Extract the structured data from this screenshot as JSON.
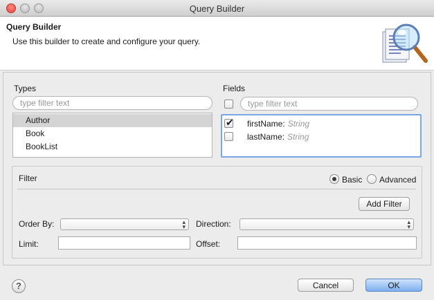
{
  "window": {
    "title": "Query Builder"
  },
  "header": {
    "title": "Query Builder",
    "description": "Use this builder to create and configure your query."
  },
  "types": {
    "label": "Types",
    "filter_placeholder": "type filter text",
    "items": [
      {
        "label": "Author",
        "selected": true
      },
      {
        "label": "Book",
        "selected": false
      },
      {
        "label": "BookList",
        "selected": false
      }
    ]
  },
  "fields": {
    "label": "Fields",
    "filter_placeholder": "type filter text",
    "select_all_checked": false,
    "items": [
      {
        "name": "firstName:",
        "type": "String",
        "checked": true
      },
      {
        "name": "lastName:",
        "type": "String",
        "checked": false
      }
    ]
  },
  "filter": {
    "label": "Filter",
    "mode_options": [
      "Basic",
      "Advanced"
    ],
    "selected_mode": "Basic",
    "add_filter_label": "Add Filter",
    "order_by_label": "Order By:",
    "order_by_value": "",
    "direction_label": "Direction:",
    "direction_value": "",
    "limit_label": "Limit:",
    "limit_value": "",
    "offset_label": "Offset:",
    "offset_value": ""
  },
  "footer": {
    "help_icon": "question-mark-icon",
    "cancel_label": "Cancel",
    "ok_label": "OK"
  },
  "colors": {
    "focus_border": "#7aa5e8",
    "primary_button": "#7eb0ef",
    "selected_row": "#d4d4d4"
  }
}
